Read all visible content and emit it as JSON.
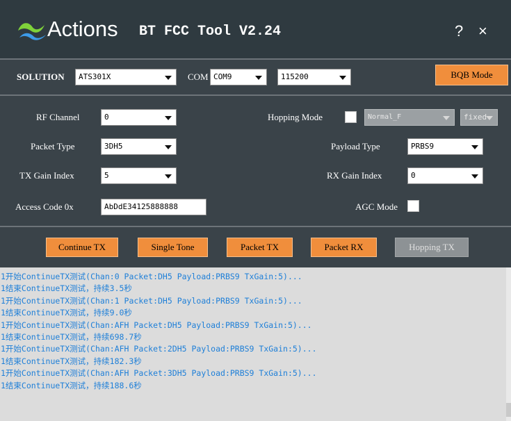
{
  "title_bar": {
    "brand": "Actions",
    "app_title": "BT FCC Tool V2.24",
    "help_label": "?",
    "close_label": "×"
  },
  "top_bar": {
    "solution_label": "SOLUTION",
    "solution_value": "ATS301X",
    "com_label": "COM",
    "com_value": "COM9",
    "baud_value": "115200",
    "bqb_button": "BQB Mode"
  },
  "settings": {
    "rf_channel_label": "RF Channel",
    "rf_channel_value": "0",
    "hopping_mode_label": "Hopping Mode",
    "hopping_mode_checked": false,
    "hopping_type_value": "Normal_F",
    "hopping_fixed_value": "fixed",
    "packet_type_label": "Packet Type",
    "packet_type_value": "3DH5",
    "payload_type_label": "Payload Type",
    "payload_type_value": "PRBS9",
    "tx_gain_label": "TX Gain Index",
    "tx_gain_value": "5",
    "rx_gain_label": "RX Gain Index",
    "rx_gain_value": "0",
    "access_code_label": "Access Code 0x",
    "access_code_value": "AbDdE34125888888",
    "agc_mode_label": "AGC Mode",
    "agc_mode_checked": false
  },
  "actions": {
    "continue_tx": "Continue TX",
    "single_tone": "Single Tone",
    "packet_tx": "Packet TX",
    "packet_rx": "Packet RX",
    "hopping_tx": "Hopping TX"
  },
  "log": [
    "1开始ContinueTX测试(Chan:0 Packet:DH5 Payload:PRBS9 TxGain:5)...",
    "1结束ContinueTX测试，持续3.5秒",
    "1开始ContinueTX测试(Chan:1 Packet:DH5 Payload:PRBS9 TxGain:5)...",
    "1结束ContinueTX测试，持续9.0秒",
    "1开始ContinueTX测试(Chan:AFH Packet:DH5 Payload:PRBS9 TxGain:5)...",
    "1结束ContinueTX测试，持续698.7秒",
    "1开始ContinueTX测试(Chan:AFH Packet:2DH5 Payload:PRBS9 TxGain:5)...",
    "1结束ContinueTX测试，持续182.3秒",
    "1开始ContinueTX测试(Chan:AFH Packet:3DH5 Payload:PRBS9 TxGain:5)...",
    "1结束ContinueTX测试，持续188.6秒"
  ],
  "colors": {
    "titlebar": "#2f3a40",
    "panel": "#3a4349",
    "orange_button": "#f08e3c",
    "log_text": "#1e7fd8",
    "logo_green": "#7fd23a",
    "logo_blue": "#3d9be9"
  }
}
